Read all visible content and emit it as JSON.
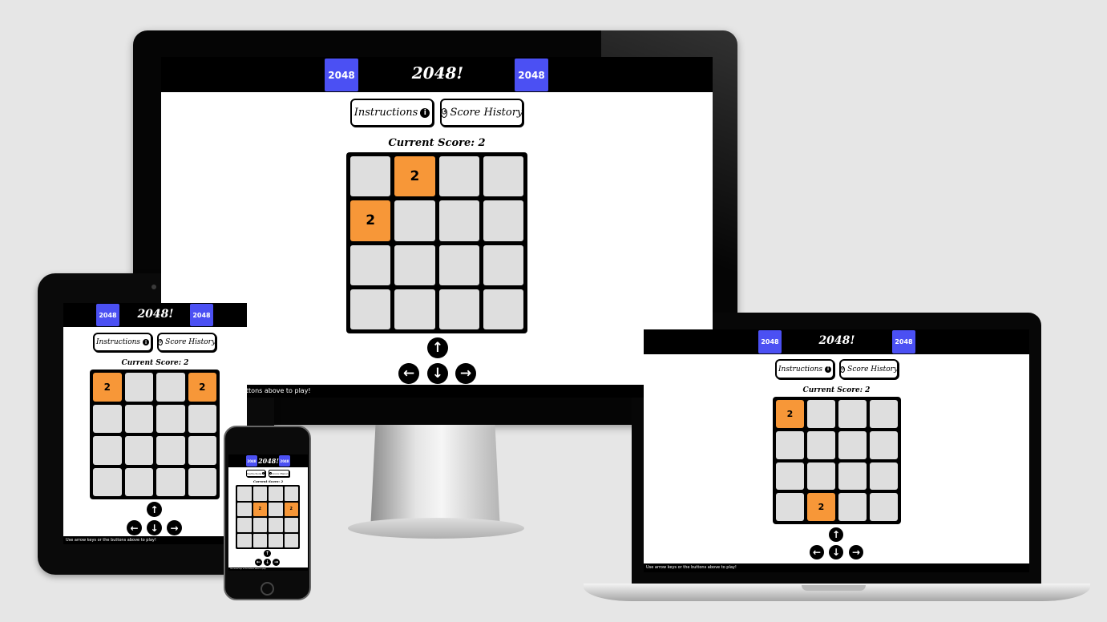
{
  "app": {
    "header_title": "2048!",
    "logo_text": "2048",
    "instructions_label": "Instructions",
    "history_label": "Score History",
    "info_icon_glyph": "i",
    "history_icon_glyph": "↺",
    "score_text": "Current Score: 2",
    "footer_text": "Use arrow keys or the buttons above to play!",
    "arrow_up": "↑",
    "arrow_left": "←",
    "arrow_down": "↓",
    "arrow_right": "→",
    "icons": {
      "info": "info-icon",
      "history": "history-icon",
      "arrow_up": "arrow-up-icon",
      "arrow_left": "arrow-left-icon",
      "arrow_down": "arrow-down-icon",
      "arrow_right": "arrow-right-icon"
    },
    "colors": {
      "logo_tile": "#4b50f3",
      "tile_2": "#f79738",
      "empty_cell": "#dedede",
      "header": "#000000"
    }
  },
  "devices": {
    "monitor": {
      "board": [
        "",
        "2",
        "",
        "",
        "2",
        "",
        "",
        "",
        "",
        "",
        "",
        "",
        "",
        "",
        "",
        ""
      ]
    },
    "tablet": {
      "board": [
        "2",
        "",
        "",
        "2",
        "",
        "",
        "",
        "",
        "",
        "",
        "",
        "",
        "",
        "",
        "",
        ""
      ]
    },
    "laptop": {
      "board": [
        "2",
        "",
        "",
        "",
        "",
        "",
        "",
        "",
        "",
        "",
        "",
        "",
        "",
        "2",
        "",
        ""
      ]
    },
    "phone": {
      "board": [
        "",
        "",
        "",
        "",
        "",
        "2",
        "",
        "2",
        "",
        "",
        "",
        "",
        "",
        "",
        "",
        ""
      ]
    }
  }
}
